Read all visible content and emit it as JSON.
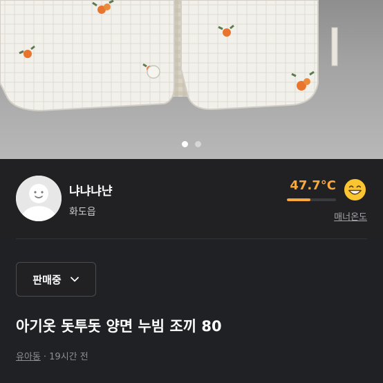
{
  "carousel": {
    "total": 2,
    "active_index": 0
  },
  "seller": {
    "name": "냐냐냐냔",
    "region": "화도읍",
    "temperature": "47.7°C",
    "temperature_level": 0.477,
    "manner_label": "매너온도",
    "emoji_icon": "grinning-face-emoji"
  },
  "product": {
    "status": "판매중",
    "title": "아기옷 돗투돗 양면 누빔 조끼 80",
    "category": "유아동",
    "posted_time": "· 19시간 전"
  },
  "colors": {
    "background": "#202124",
    "accent_temperature": "#f9a83e",
    "muted_text": "#8e8f94"
  }
}
